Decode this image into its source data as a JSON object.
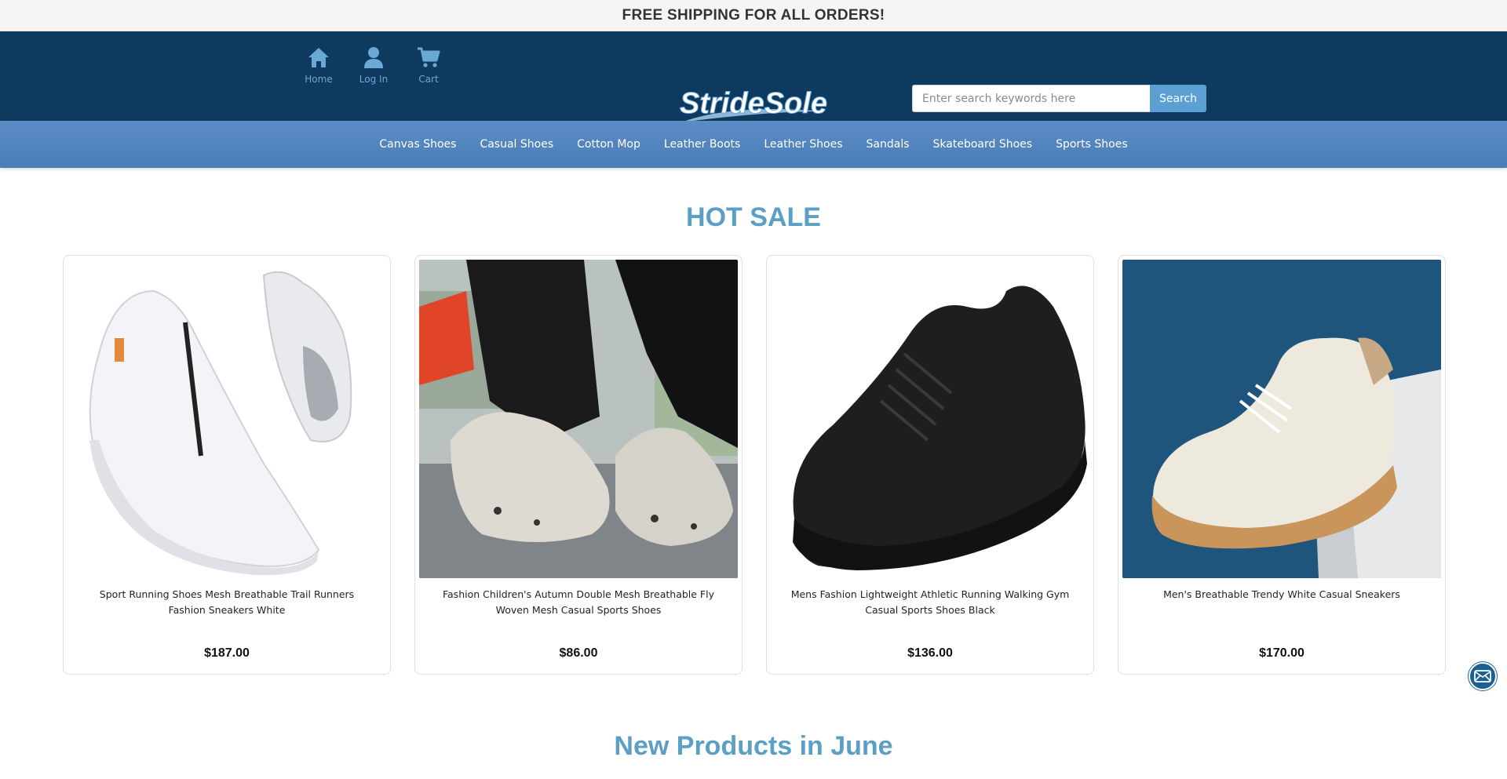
{
  "announcement": "FREE SHIPPING FOR ALL ORDERS!",
  "header": {
    "nav": [
      {
        "label": "Home",
        "icon": "home-icon"
      },
      {
        "label": "Log In",
        "icon": "user-icon"
      },
      {
        "label": "Cart",
        "icon": "cart-icon"
      }
    ],
    "logo_text": "StrideSole",
    "search": {
      "placeholder": "Enter search keywords here",
      "button": "Search"
    }
  },
  "categories": [
    "Canvas Shoes",
    "Casual Shoes",
    "Cotton Mop",
    "Leather Boots",
    "Leather Shoes",
    "Sandals",
    "Skateboard Shoes",
    "Sports Shoes"
  ],
  "hot_sale": {
    "title": "HOT SALE",
    "products": [
      {
        "name": "Sport Running Shoes Mesh Breathable Trail Runners Fashion Sneakers White",
        "price": "$187.00"
      },
      {
        "name": "Fashion Children's Autumn Double Mesh Breathable Fly Woven Mesh Casual Sports Shoes",
        "price": "$86.00"
      },
      {
        "name": "Mens Fashion Lightweight Athletic Running Walking Gym Casual Sports Shoes Black",
        "price": "$136.00"
      },
      {
        "name": "Men's Breathable Trendy White Casual Sneakers",
        "price": "$170.00"
      }
    ]
  },
  "new_products": {
    "title": "New Products in June"
  },
  "colors": {
    "header_bg": "#0f3a5f",
    "nav_bg": "#5c8cc4",
    "accent": "#5b9fc4",
    "search_button": "#5b9fd3"
  },
  "floating": {
    "icon": "mail-icon"
  }
}
